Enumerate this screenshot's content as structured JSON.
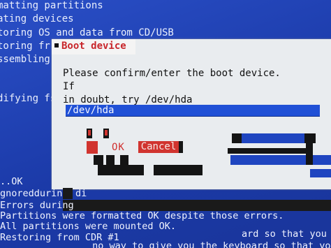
{
  "background_lines": [
    "matting partitions",
    "ating devices",
    "toring OS and data from CD/USB",
    "toring fr",
    "ssembling",
    "difying fs"
  ],
  "dialog": {
    "title": "Boot device",
    "prompt": "Please confirm/enter the boot device. If\nin doubt, try /dev/hda",
    "input_value": "/dev/hda",
    "ok_label": "OK",
    "cancel_label": "Cancel"
  },
  "terminal": {
    "line_ok": "..OK",
    "line_ignored": "gnoredduring",
    "line_ignored_tail": "di",
    "line_errors": "Errors during",
    "line_formatted": "Partitions were formatted OK despite those errors.",
    "line_mounted": "All partitions were mounted OK.",
    "line_restoring": "Restoring from CDR #1",
    "line_right": "ard so that you edi",
    "line_bottom": "                 no way to give you the keyboard so that you edi"
  },
  "colors": {
    "screen_blue": "#1f45c0",
    "dialog_bg": "#e9ecef",
    "accent_red": "#d1342f",
    "field_blue": "#2050d6"
  }
}
